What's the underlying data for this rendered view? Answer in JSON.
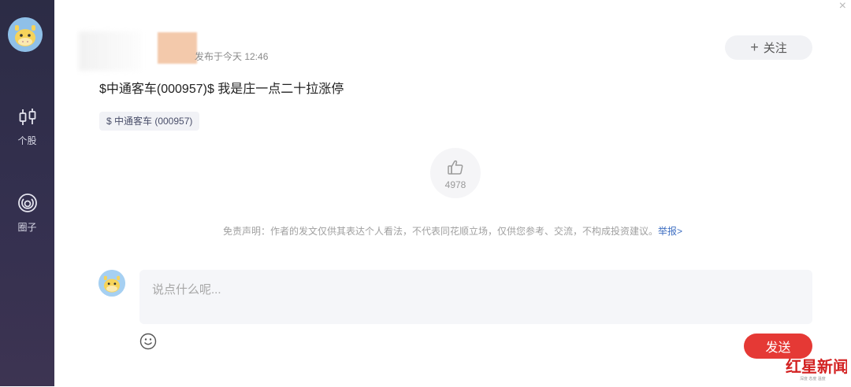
{
  "sidebar": {
    "items": [
      {
        "label": "个股",
        "icon": "stock-candlestick-icon"
      },
      {
        "label": "圈子",
        "icon": "circle-community-icon"
      }
    ]
  },
  "post": {
    "time": "发布于今天 12:46",
    "content": "$中通客车(000957)$ 我是庄一点二十拉涨停",
    "stock_tag": "$ 中通客车 (000957)",
    "like_count": "4978"
  },
  "header": {
    "follow_label": "关注",
    "close_icon": "×"
  },
  "disclaimer": {
    "text": "免责声明：作者的发文仅供其表达个人看法，不代表同花顺立场，仅供您参考、交流，不构成投资建议。",
    "report_link": "举报>"
  },
  "comment": {
    "placeholder": "说点什么呢...",
    "send_label": "发送"
  },
  "colors": {
    "sidebar": "#2e2d48",
    "send": "#e53935",
    "link": "#3f6fc2"
  }
}
